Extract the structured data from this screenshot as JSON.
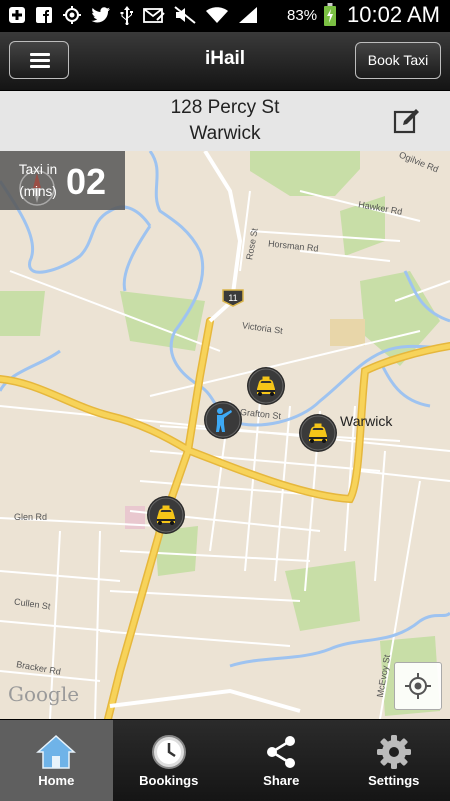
{
  "status_bar": {
    "battery_percent": "83%",
    "time": "10:02 AM",
    "icons": [
      "add-icon",
      "facebook-icon",
      "location-icon",
      "twitter-icon",
      "usb-icon",
      "email-icon",
      "mute-icon",
      "wifi-icon",
      "signal-icon",
      "battery-charging-icon"
    ]
  },
  "header": {
    "title": "iHail",
    "book_label": "Book Taxi",
    "menu_icon": "hamburger-icon"
  },
  "address": {
    "line1": "128 Percy St",
    "line2": "Warwick",
    "edit_icon": "edit-icon"
  },
  "eta": {
    "label": "Taxi in (mins)",
    "value": "02"
  },
  "map": {
    "town_label": "Warwick",
    "route_number": "11",
    "streets": [
      "Ogilvie Rd",
      "Hawker Rd",
      "Horsman Rd",
      "Rose St",
      "Victoria St",
      "Grafton St",
      "Glen Rd",
      "Cullen St",
      "Bracker Rd",
      "McEvoy St"
    ],
    "attribution": "Google",
    "markers": [
      "taxi",
      "taxi",
      "taxi",
      "passenger"
    ],
    "colors": {
      "background": "#ece3d4",
      "highway": "#f7d35a",
      "water": "#9ec3f0",
      "park": "#c8dea7"
    }
  },
  "tabs": [
    {
      "label": "Home",
      "icon": "home-icon",
      "active": true
    },
    {
      "label": "Bookings",
      "icon": "clock-icon",
      "active": false
    },
    {
      "label": "Share",
      "icon": "share-icon",
      "active": false
    },
    {
      "label": "Settings",
      "icon": "gear-icon",
      "active": false
    }
  ]
}
